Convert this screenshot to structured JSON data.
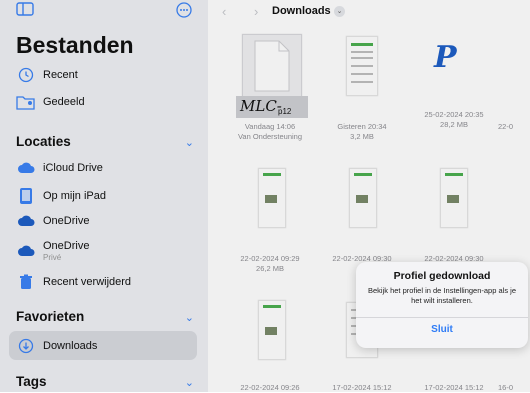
{
  "sidebar": {
    "title": "Bestanden",
    "items": [
      {
        "label": "Recent"
      },
      {
        "label": "Gedeeld"
      }
    ],
    "sections": {
      "locations": "Locaties",
      "favorites": "Favorieten",
      "tags": "Tags"
    },
    "locations": [
      {
        "label": "iCloud Drive"
      },
      {
        "label": "Op mijn iPad"
      },
      {
        "label": "OneDrive"
      },
      {
        "label": "OneDrive",
        "sub": "Privé"
      },
      {
        "label": "Recent verwijderd"
      }
    ],
    "favorites": [
      {
        "label": "Downloads"
      }
    ]
  },
  "toolbar": {
    "breadcrumb": "Downloads"
  },
  "files": [
    {
      "date": "Vandaag 14:06",
      "meta": "Van Ondersteuning",
      "handwriting": "MLC-",
      "handwriting_sub": "p12"
    },
    {
      "date": "Gisteren 20:34",
      "meta": "3,2 MB"
    },
    {
      "date": "25-02-2024 20:35",
      "meta": "28,2 MB"
    },
    {
      "date": "22-0",
      "meta": ""
    },
    {
      "date": "22-02-2024 09:29",
      "meta": "26,2 MB"
    },
    {
      "date": "22-02-2024 09:30",
      "meta": "2("
    },
    {
      "date": "22-02-2024 09:30",
      "meta": ""
    },
    {
      "date": "22-02-2024 09:26",
      "meta": ""
    },
    {
      "date": "17-02-2024 15:12",
      "meta": ""
    },
    {
      "date": "17-02-2024 15:12",
      "meta": ""
    },
    {
      "date": "16-0",
      "meta": ""
    }
  ],
  "dialog": {
    "title": "Profiel gedownload",
    "message": "Bekijk het profiel in de Instellingen-app als je het wilt installeren.",
    "button": "Sluit"
  },
  "colors": {
    "accent": "#2f7cf6",
    "sidebar_bg": "#eef0f4"
  },
  "icons": [
    "sidebar-toggle-icon",
    "more-icon",
    "clock-icon",
    "shared-folder-icon",
    "cloud-icon",
    "ipad-icon",
    "trash-icon",
    "download-icon",
    "chevron-down-icon",
    "back-icon",
    "forward-icon"
  ]
}
